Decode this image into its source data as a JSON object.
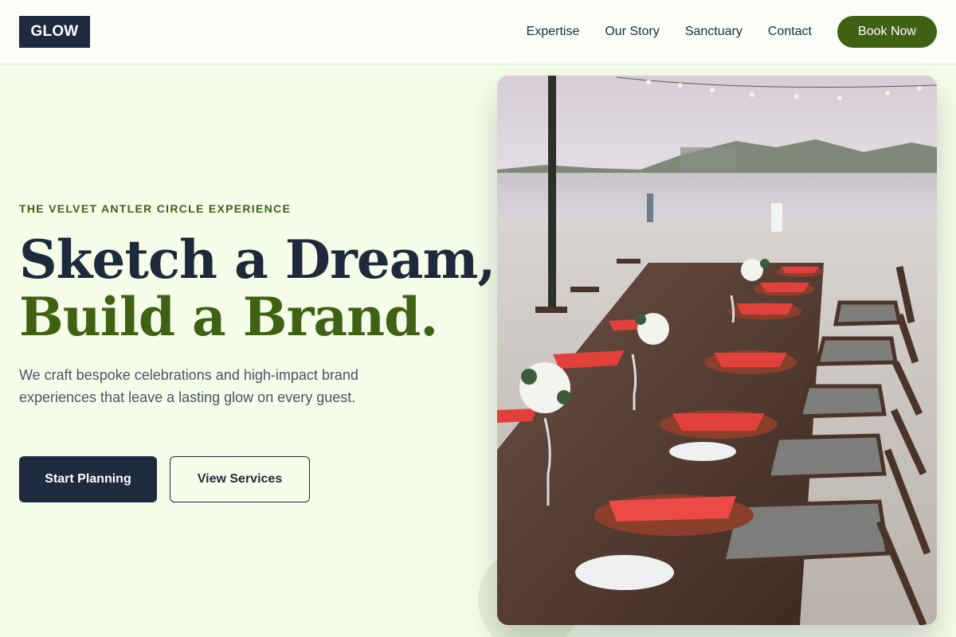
{
  "header": {
    "logo": "GLOW",
    "nav": [
      "Expertise",
      "Our Story",
      "Sanctuary",
      "Contact"
    ],
    "cta": "Book Now"
  },
  "hero": {
    "eyebrow": "THE VELVET ANTLER CIRCLE EXPERIENCE",
    "headline_line1": "Sketch a Dream,",
    "headline_line2": "Build a Brand.",
    "description": "We craft bespoke celebrations and high-impact brand experiences that leave a lasting glow on every guest.",
    "primary_button": "Start Planning",
    "secondary_button": "View Services",
    "image_subject": "beach banquet table with red napkins and wooden chairs"
  },
  "colors": {
    "navy": "#1e2a3e",
    "olive": "#3f6212",
    "background": "#f6fde9"
  }
}
